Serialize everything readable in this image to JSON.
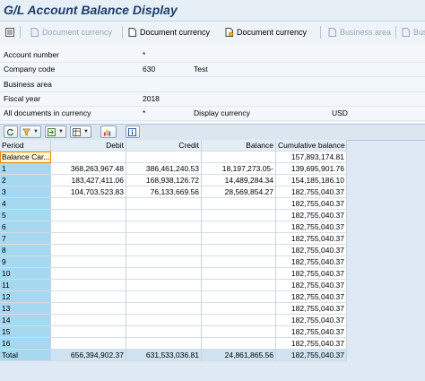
{
  "window": {
    "title": "G/L Account Balance Display"
  },
  "toolbar": {
    "items": [
      {
        "label": "",
        "enabled": true
      },
      {
        "label": "Document currency",
        "enabled": false
      },
      {
        "label": "Document currency",
        "enabled": true
      },
      {
        "label": "Document currency",
        "enabled": true
      },
      {
        "label": "Business area",
        "enabled": false
      },
      {
        "label": "Bus",
        "enabled": false
      }
    ]
  },
  "header": {
    "account_number_label": "Account number",
    "account_number_value": "*",
    "company_code_label": "Company code",
    "company_code_value": "630",
    "company_name": "Test",
    "business_area_label": "Business area",
    "fiscal_year_label": "Fiscal year",
    "fiscal_year_value": "2018",
    "all_docs_label": "All documents in currency",
    "all_docs_value": "*",
    "display_currency_label": "Display currency",
    "display_currency_value": "USD"
  },
  "grid": {
    "columns": [
      "Period",
      "Debit",
      "Credit",
      "Balance",
      "Cumulative balance"
    ],
    "rows": [
      {
        "period": "Balance Car...",
        "debit": "",
        "credit": "",
        "balance": "",
        "cumulative": "157,893,174.81"
      },
      {
        "period": "1",
        "debit": "368,263,967.48",
        "credit": "386,461,240.53",
        "balance": "18,197,273.05-",
        "cumulative": "139,695,901.76"
      },
      {
        "period": "2",
        "debit": "183,427,411.06",
        "credit": "168,938,126.72",
        "balance": "14,489,284.34",
        "cumulative": "154,185,186.10"
      },
      {
        "period": "3",
        "debit": "104,703,523.83",
        "credit": "76,133,669.56",
        "balance": "28,569,854.27",
        "cumulative": "182,755,040.37"
      },
      {
        "period": "4",
        "debit": "",
        "credit": "",
        "balance": "",
        "cumulative": "182,755,040.37"
      },
      {
        "period": "5",
        "debit": "",
        "credit": "",
        "balance": "",
        "cumulative": "182,755,040.37"
      },
      {
        "period": "6",
        "debit": "",
        "credit": "",
        "balance": "",
        "cumulative": "182,755,040.37"
      },
      {
        "period": "7",
        "debit": "",
        "credit": "",
        "balance": "",
        "cumulative": "182,755,040.37"
      },
      {
        "period": "8",
        "debit": "",
        "credit": "",
        "balance": "",
        "cumulative": "182,755,040.37"
      },
      {
        "period": "9",
        "debit": "",
        "credit": "",
        "balance": "",
        "cumulative": "182,755,040.37"
      },
      {
        "period": "10",
        "debit": "",
        "credit": "",
        "balance": "",
        "cumulative": "182,755,040.37"
      },
      {
        "period": "11",
        "debit": "",
        "credit": "",
        "balance": "",
        "cumulative": "182,755,040.37"
      },
      {
        "period": "12",
        "debit": "",
        "credit": "",
        "balance": "",
        "cumulative": "182,755,040.37"
      },
      {
        "period": "13",
        "debit": "",
        "credit": "",
        "balance": "",
        "cumulative": "182,755,040.37"
      },
      {
        "period": "14",
        "debit": "",
        "credit": "",
        "balance": "",
        "cumulative": "182,755,040.37"
      },
      {
        "period": "15",
        "debit": "",
        "credit": "",
        "balance": "",
        "cumulative": "182,755,040.37"
      },
      {
        "period": "16",
        "debit": "",
        "credit": "",
        "balance": "",
        "cumulative": "182,755,040.37"
      }
    ],
    "total": {
      "period": "Total",
      "debit": "656,394,902.37",
      "credit": "631,533,036.81",
      "balance": "24,861,865.56",
      "cumulative": "182,755,040.37"
    }
  },
  "icons": [
    "overview-icon",
    "document-icon",
    "refresh-icon",
    "filter-icon",
    "export-icon",
    "layout-icon",
    "chart-icon",
    "info-icon"
  ]
}
